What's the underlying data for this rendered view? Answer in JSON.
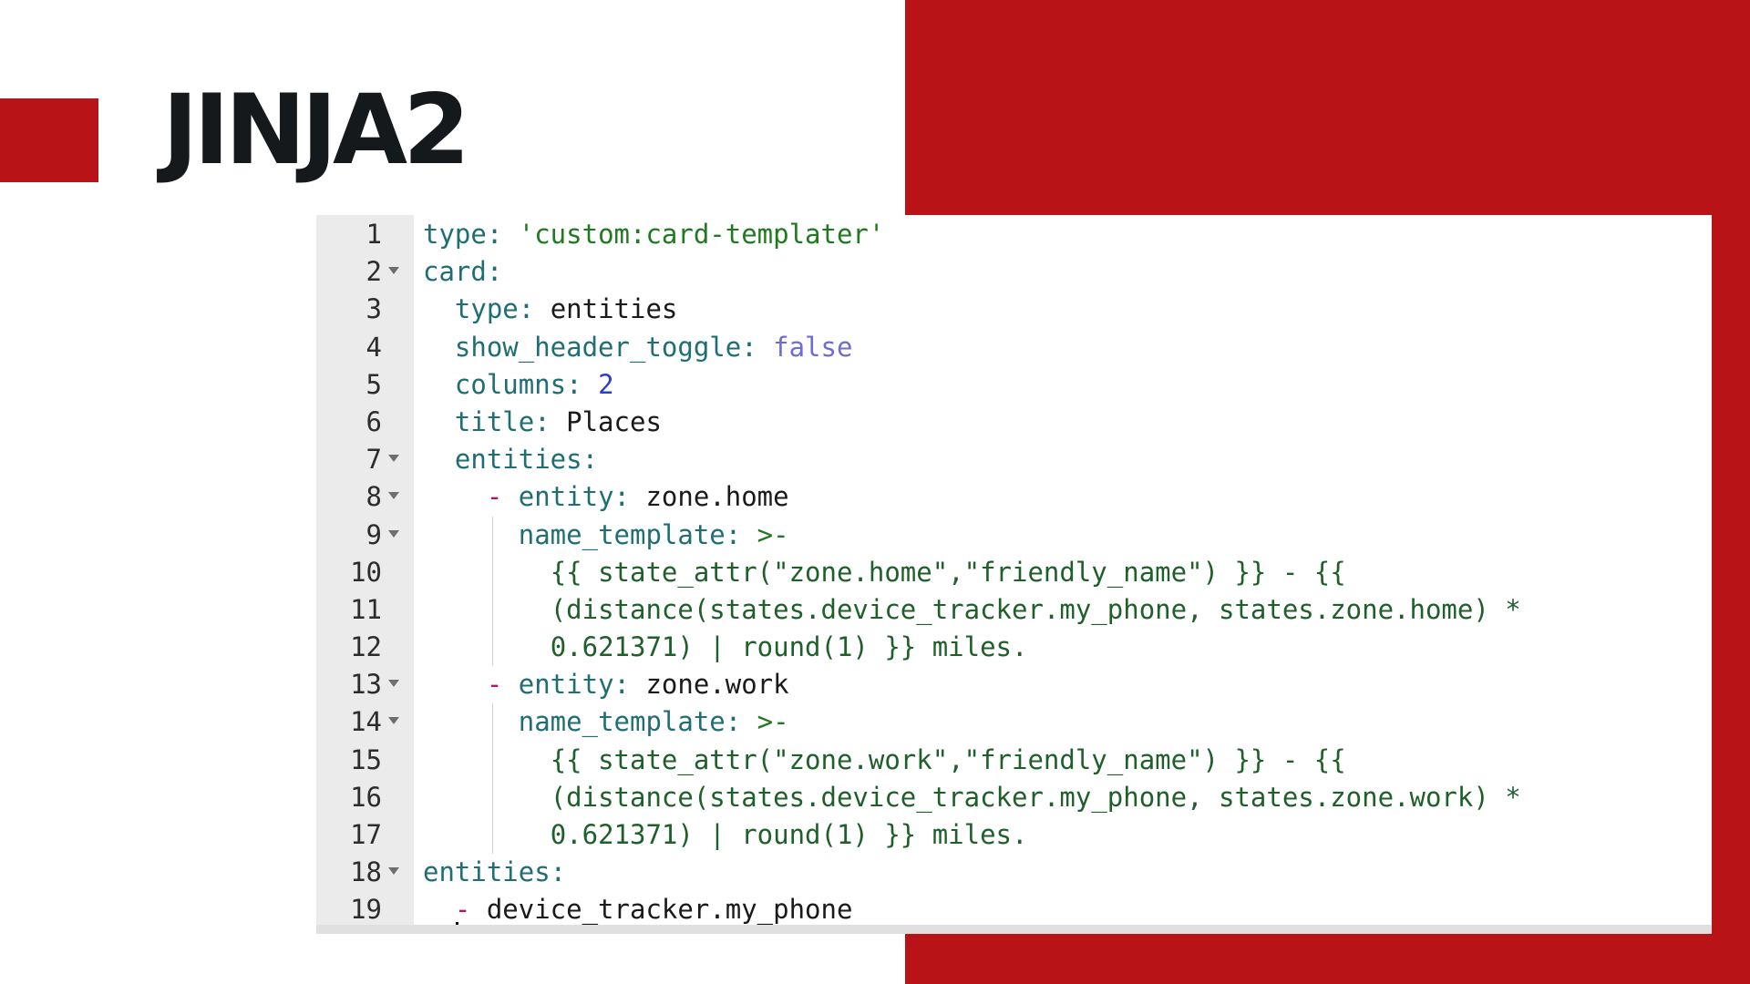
{
  "slide": {
    "title": "JINJA2"
  },
  "colors": {
    "brand_red": "#b81417",
    "title_text": "#15191b",
    "gutter_bg": "#ebebeb"
  },
  "editor": {
    "lines": [
      {
        "num": "1",
        "fold": false,
        "guide": false,
        "tokens": [
          [
            "key",
            "type: "
          ],
          [
            "str",
            "'custom:card-templater'"
          ]
        ]
      },
      {
        "num": "2",
        "fold": true,
        "guide": false,
        "tokens": [
          [
            "key",
            "card:"
          ]
        ]
      },
      {
        "num": "3",
        "fold": false,
        "guide": false,
        "tokens": [
          [
            "text",
            "  "
          ],
          [
            "key",
            "type: "
          ],
          [
            "text",
            "entities"
          ]
        ]
      },
      {
        "num": "4",
        "fold": false,
        "guide": false,
        "tokens": [
          [
            "text",
            "  "
          ],
          [
            "key",
            "show_header_toggle: "
          ],
          [
            "bool",
            "false"
          ]
        ]
      },
      {
        "num": "5",
        "fold": false,
        "guide": false,
        "tokens": [
          [
            "text",
            "  "
          ],
          [
            "key",
            "columns: "
          ],
          [
            "num",
            "2"
          ]
        ]
      },
      {
        "num": "6",
        "fold": false,
        "guide": false,
        "tokens": [
          [
            "text",
            "  "
          ],
          [
            "key",
            "title: "
          ],
          [
            "text",
            "Places"
          ]
        ]
      },
      {
        "num": "7",
        "fold": true,
        "guide": false,
        "tokens": [
          [
            "text",
            "  "
          ],
          [
            "key",
            "entities:"
          ]
        ]
      },
      {
        "num": "8",
        "fold": true,
        "guide": false,
        "tokens": [
          [
            "text",
            "    "
          ],
          [
            "dash",
            "- "
          ],
          [
            "key",
            "entity: "
          ],
          [
            "text",
            "zone.home"
          ]
        ]
      },
      {
        "num": "9",
        "fold": true,
        "guide": true,
        "tokens": [
          [
            "text",
            "      "
          ],
          [
            "key",
            "name_template: "
          ],
          [
            "str",
            ">-"
          ]
        ]
      },
      {
        "num": "10",
        "fold": false,
        "guide": true,
        "tokens": [
          [
            "text",
            "        "
          ],
          [
            "tpl",
            "{{ state_attr(\"zone.home\",\"friendly_name\") }} - {{"
          ]
        ]
      },
      {
        "num": "11",
        "fold": false,
        "guide": true,
        "tokens": [
          [
            "text",
            "        "
          ],
          [
            "tpl",
            "(distance(states.device_tracker.my_phone, states.zone.home) *"
          ]
        ]
      },
      {
        "num": "12",
        "fold": false,
        "guide": true,
        "tokens": [
          [
            "text",
            "        "
          ],
          [
            "tpl",
            "0.621371) | round(1) }} miles."
          ]
        ]
      },
      {
        "num": "13",
        "fold": true,
        "guide": false,
        "tokens": [
          [
            "text",
            "    "
          ],
          [
            "dash",
            "- "
          ],
          [
            "key",
            "entity: "
          ],
          [
            "text",
            "zone.work"
          ]
        ]
      },
      {
        "num": "14",
        "fold": true,
        "guide": true,
        "tokens": [
          [
            "text",
            "      "
          ],
          [
            "key",
            "name_template: "
          ],
          [
            "str",
            ">-"
          ]
        ]
      },
      {
        "num": "15",
        "fold": false,
        "guide": true,
        "tokens": [
          [
            "text",
            "        "
          ],
          [
            "tpl",
            "{{ state_attr(\"zone.work\",\"friendly_name\") }} - {{"
          ]
        ]
      },
      {
        "num": "16",
        "fold": false,
        "guide": true,
        "tokens": [
          [
            "text",
            "        "
          ],
          [
            "tpl",
            "(distance(states.device_tracker.my_phone, states.zone.work) *"
          ]
        ]
      },
      {
        "num": "17",
        "fold": false,
        "guide": true,
        "tokens": [
          [
            "text",
            "        "
          ],
          [
            "tpl",
            "0.621371) | round(1) }} miles."
          ]
        ]
      },
      {
        "num": "18",
        "fold": true,
        "guide": false,
        "tokens": [
          [
            "key",
            "entities:"
          ]
        ]
      },
      {
        "num": "19",
        "fold": false,
        "guide": false,
        "tokens": [
          [
            "text",
            "  "
          ],
          [
            "dash",
            "- "
          ],
          [
            "text",
            "device_tracker.my_phone"
          ]
        ]
      }
    ]
  }
}
